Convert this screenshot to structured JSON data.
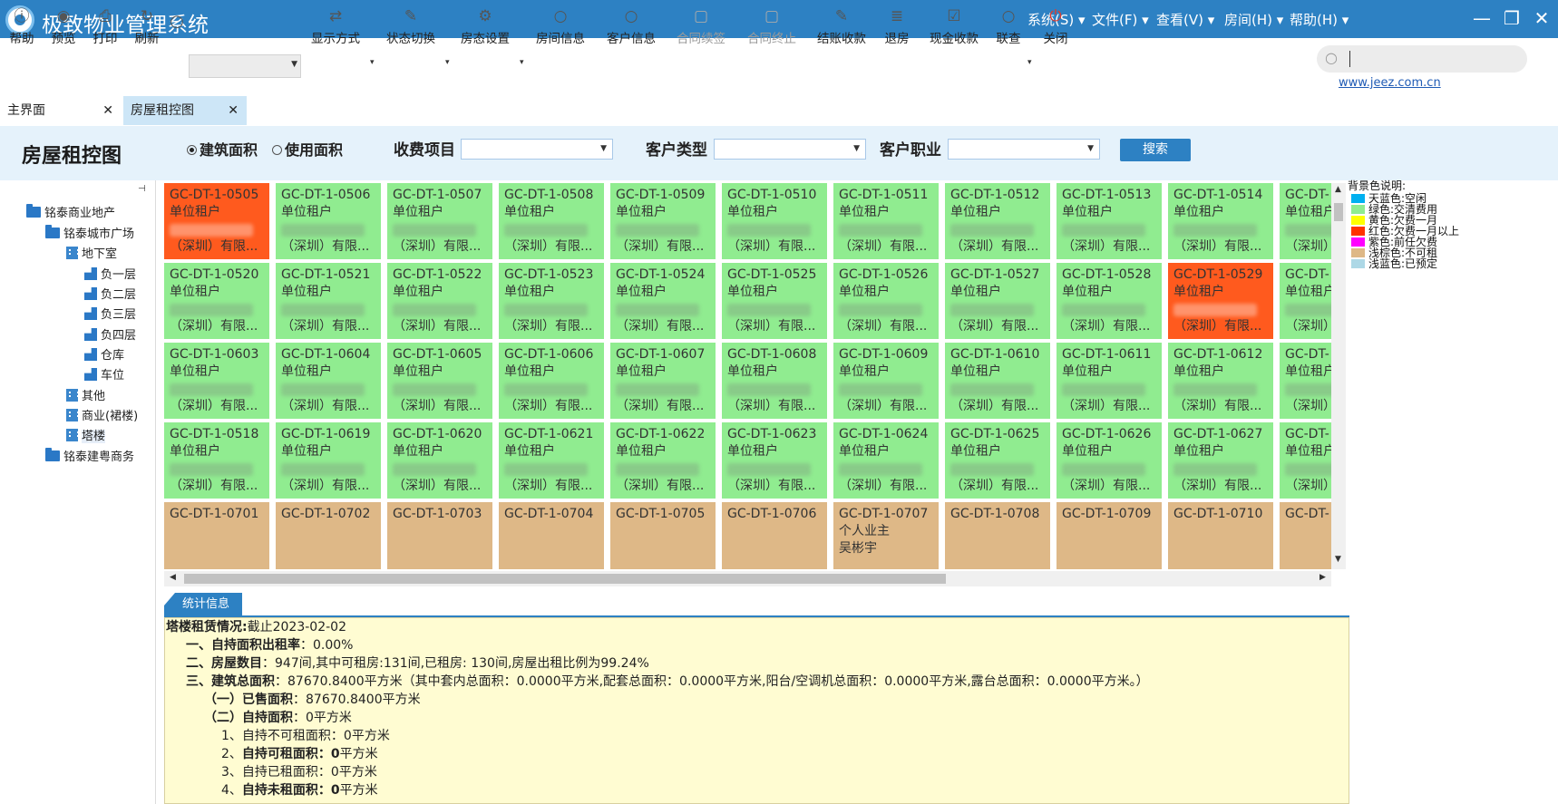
{
  "app": {
    "title": "极致物业管理系统"
  },
  "menus": [
    "系统(S)",
    "文件(F)",
    "查看(V)",
    "房间(H)",
    "帮助(H)"
  ],
  "window_controls": {
    "minimize": "—",
    "maximize": "❐",
    "close": "✕"
  },
  "toolbar": {
    "help": "帮助",
    "preview": "预览",
    "print": "打印",
    "refresh": "刷新",
    "display_mode": "显示方式",
    "status_switch": "状态切换",
    "room_status_settings": "房态设置",
    "room_info": "房间信息",
    "customer_info": "客户信息",
    "contract_renew": "合同续签",
    "contract_terminate": "合同终止",
    "settle_charge": "结账收款",
    "return_room": "退房",
    "cash_charge": "现金收款",
    "query": "联查",
    "close": "关闭",
    "link": "www.jeez.com.cn"
  },
  "tabs": [
    {
      "label": "主界面"
    },
    {
      "label": "房屋租控图"
    }
  ],
  "filters": {
    "page_title": "房屋租控图",
    "radio_building_area": "建筑面积",
    "radio_usable_area": "使用面积",
    "fee_item_label": "收费项目",
    "customer_type_label": "客户类型",
    "customer_occupation_label": "客户职业",
    "search_button": "搜索"
  },
  "tree": [
    {
      "label": "铭泰商业地产"
    },
    {
      "label": "铭泰城市广场"
    },
    {
      "label": "地下室"
    },
    {
      "label": "负一层"
    },
    {
      "label": "负二层"
    },
    {
      "label": "负三层"
    },
    {
      "label": "负四层"
    },
    {
      "label": "仓库"
    },
    {
      "label": "车位"
    },
    {
      "label": "其他"
    },
    {
      "label": "商业(裙楼)"
    },
    {
      "label": "塔楼"
    },
    {
      "label": "铭泰建粤商务"
    }
  ],
  "grid": {
    "unit_type": "单位租户",
    "tenant_suffix": "（深圳）有限...",
    "tenant_suffix_short": "（深圳）",
    "row1": [
      "GC-DT-1-0505",
      "GC-DT-1-0506",
      "GC-DT-1-0507",
      "GC-DT-1-0508",
      "GC-DT-1-0509",
      "GC-DT-1-0510",
      "GC-DT-1-0511",
      "GC-DT-1-0512",
      "GC-DT-1-0513",
      "GC-DT-1-0514",
      "GC-DT-"
    ],
    "row2": [
      "GC-DT-1-0520",
      "GC-DT-1-0521",
      "GC-DT-1-0522",
      "GC-DT-1-0523",
      "GC-DT-1-0524",
      "GC-DT-1-0525",
      "GC-DT-1-0526",
      "GC-DT-1-0527",
      "GC-DT-1-0528",
      "GC-DT-1-0529",
      "GC-DT-"
    ],
    "row3": [
      "GC-DT-1-0603",
      "GC-DT-1-0604",
      "GC-DT-1-0605",
      "GC-DT-1-0606",
      "GC-DT-1-0607",
      "GC-DT-1-0608",
      "GC-DT-1-0609",
      "GC-DT-1-0610",
      "GC-DT-1-0611",
      "GC-DT-1-0612",
      "GC-DT-"
    ],
    "row4": [
      "GC-DT-1-0518",
      "GC-DT-1-0619",
      "GC-DT-1-0620",
      "GC-DT-1-0621",
      "GC-DT-1-0622",
      "GC-DT-1-0623",
      "GC-DT-1-0624",
      "GC-DT-1-0625",
      "GC-DT-1-0626",
      "GC-DT-1-0627",
      "GC-DT-"
    ],
    "row5": [
      "GC-DT-1-0701",
      "GC-DT-1-0702",
      "GC-DT-1-0703",
      "GC-DT-1-0704",
      "GC-DT-1-0705",
      "GC-DT-1-0706",
      "GC-DT-1-0707",
      "GC-DT-1-0708",
      "GC-DT-1-0709",
      "GC-DT-1-0710",
      "GC-DT-"
    ],
    "owner_type": "个人业主",
    "owner_name": "吴彬宇",
    "colors": {
      "vacant_green": "#90ec90",
      "red": "#ff5a1e",
      "tan": "#deb887"
    }
  },
  "legend": {
    "title": "背景色说明:",
    "items": [
      {
        "label": "天蓝色:空闲",
        "color": "#00b0f0"
      },
      {
        "label": "绿色:交清费用",
        "color": "#90ec90"
      },
      {
        "label": "黄色:欠费一月",
        "color": "#ffff00"
      },
      {
        "label": "红色:欠费一月以上",
        "color": "#ff3300"
      },
      {
        "label": "紫色:前任欠费",
        "color": "#ff00ff"
      },
      {
        "label": "浅棕色:不可租",
        "color": "#deb887"
      },
      {
        "label": "浅蓝色:已预定",
        "color": "#add8e6"
      }
    ]
  },
  "stats": {
    "tab": "统计信息",
    "heading_bold": "塔楼租赁情况:",
    "heading_rest": "截止2023-02-02",
    "l1_bold": "一、自持面积出租率",
    "l1_rest": "：0.00%",
    "l2_bold": "二、房屋数目",
    "l2_rest": "：947间,其中可租房:131间,已租房: 130间,房屋出租比例为99.24%",
    "l3_bold": "三、建筑总面积",
    "l3_rest": "：87670.8400平方米（其中套内总面积：0.0000平方米,配套总面积：0.0000平方米,阳台/空调机总面积：0.0000平方米,露台总面积：0.0000平方米。）",
    "l4_bold": "（一）已售面积",
    "l4_rest": "：87670.8400平方米",
    "l5_bold": "（二）自持面积",
    "l5_rest": "：0平方米",
    "l6_rest": "1、自持不可租面积：0平方米",
    "l7_pre": "2、",
    "l7_bold": "自持可租面积：0",
    "l7_rest": "平方米",
    "l8_rest": "3、自持已租面积：0平方米",
    "l9_pre": "4、",
    "l9_bold": "自持未租面积：0",
    "l9_rest": "平方米"
  }
}
